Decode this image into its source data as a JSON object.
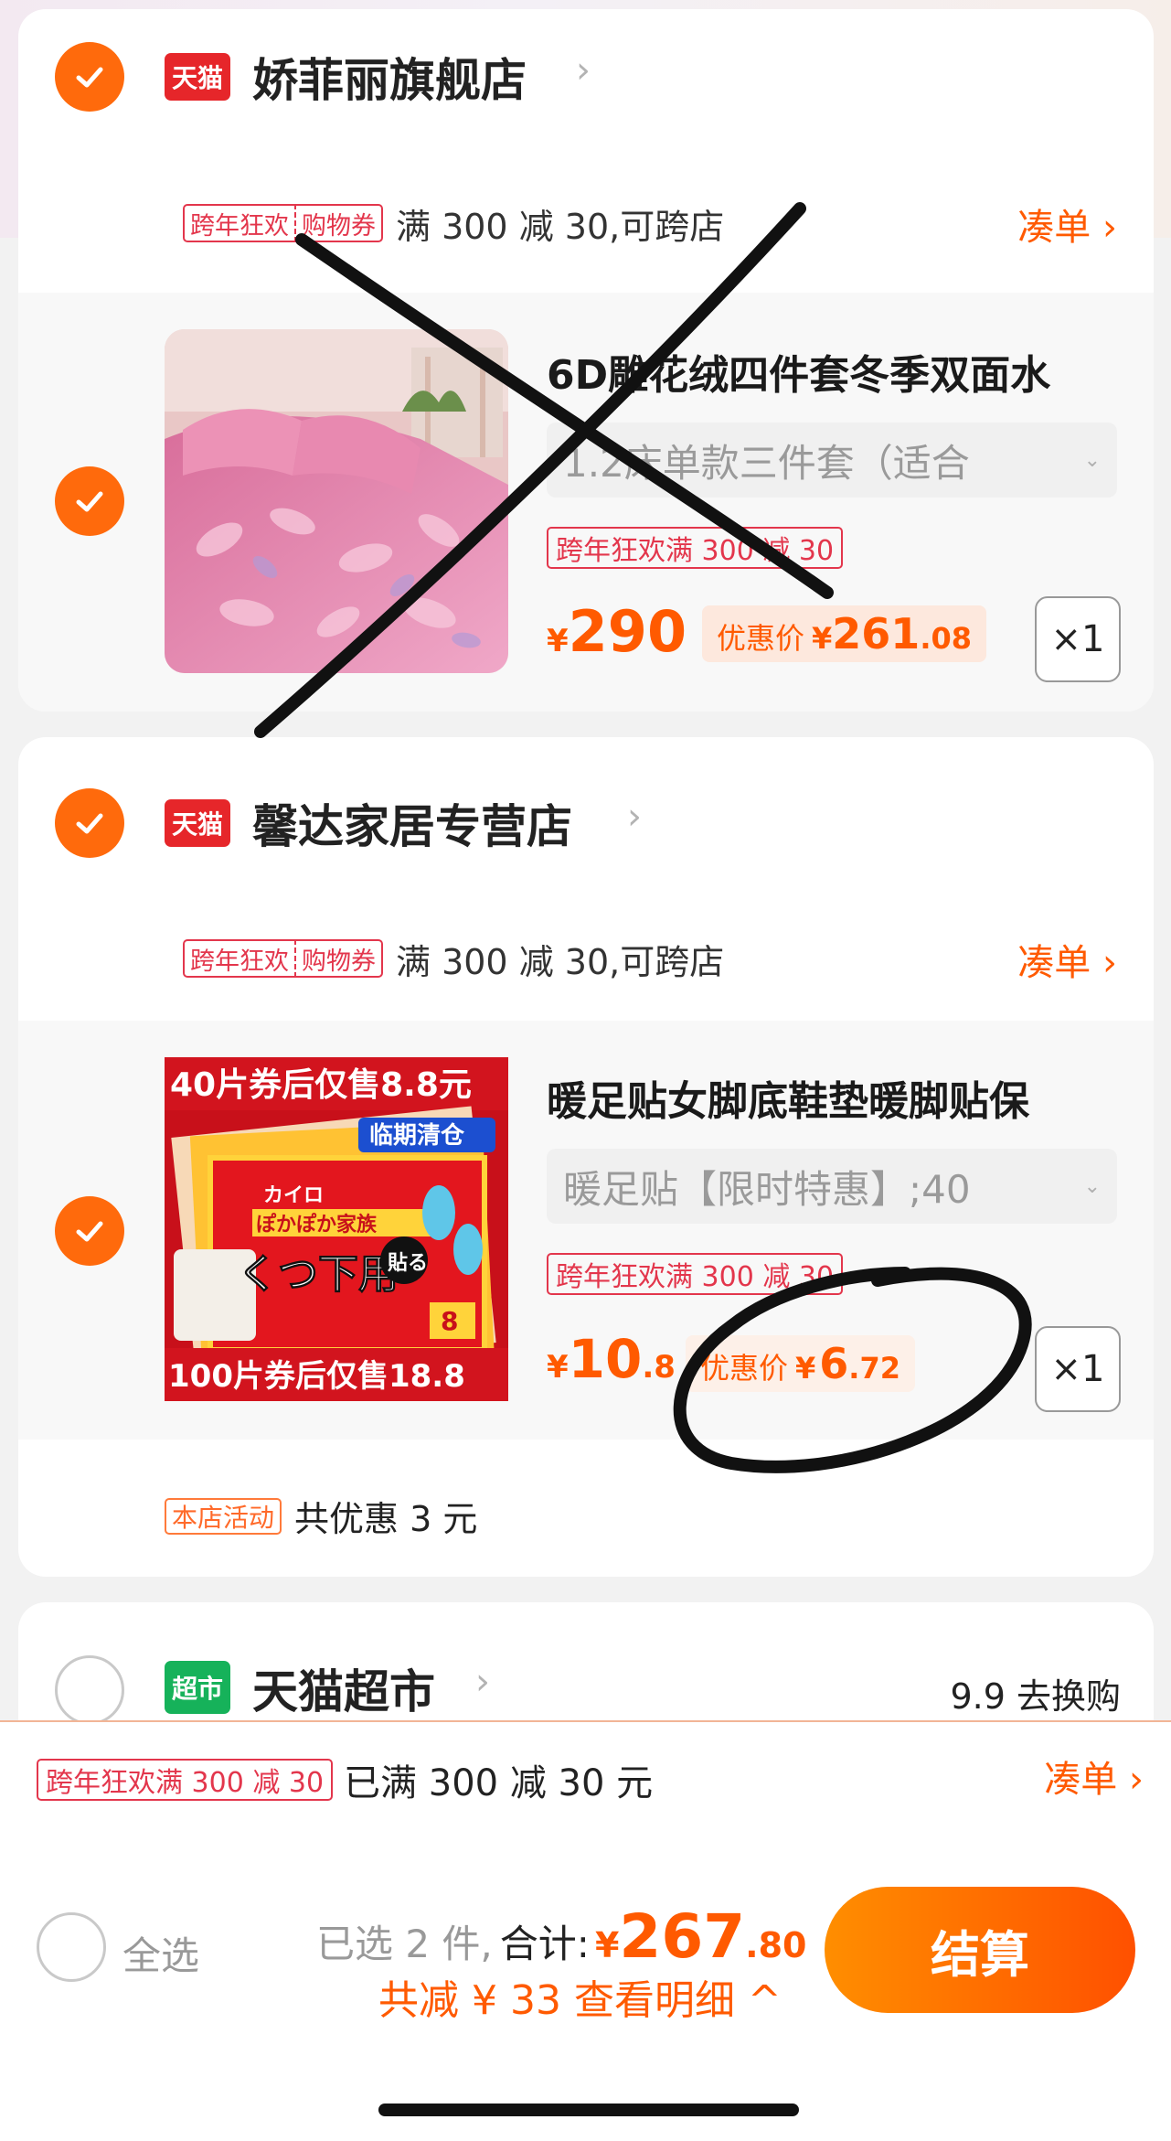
{
  "shops": [
    {
      "name": "娇菲丽旗舰店",
      "logo_text": "天猫",
      "promo_tags": [
        "跨年狂欢",
        "购物券"
      ],
      "promo_text": "满 300 减 30,可跨店",
      "cou_label": "凑单 ›",
      "item": {
        "title": "6D雕花绒四件套冬季双面水",
        "sku": "1.2床单款三件套（适合",
        "price_tag": "跨年狂欢满 300 减 30",
        "currency": "¥",
        "price": "290",
        "discount_label": "优惠价",
        "discount_currency": "¥",
        "discount_int": "261",
        "discount_dec": ".08",
        "qty": "×1"
      }
    },
    {
      "name": "馨达家居专营店",
      "logo_text": "天猫",
      "promo_tags": [
        "跨年狂欢",
        "购物券"
      ],
      "promo_text": "满 300 减 30,可跨店",
      "cou_label": "凑单 ›",
      "item": {
        "title": "暖足贴女脚底鞋垫暖脚贴保",
        "sku": "暖足贴【限时特惠】;40",
        "price_tag": "跨年狂欢满 300 减 30",
        "currency": "¥",
        "price": "10",
        "price_dec": ".8",
        "discount_label": "优惠价",
        "discount_currency": "¥",
        "discount_int": "6",
        "discount_dec": ".72",
        "qty": "×1",
        "image_text": {
          "top": "40片券后仅售8.8元",
          "badge": "临期清仓",
          "brand": "カイロ",
          "sub": "ぽかぽか家族",
          "main": "くつ下用",
          "tie": "貼る",
          "hours": "8",
          "bottom": "100片券后仅售18.8"
        }
      },
      "store_activity_tag": "本店活动",
      "store_activity_text": "共优惠 3 元"
    },
    {
      "name": "天猫超市",
      "logo_text": "超市",
      "right_text": "9.9 去换购"
    }
  ],
  "bottom_bar": {
    "promo_tag": "跨年狂欢满 300 减 30",
    "promo_text": "已满 300 减 30 元",
    "cou_label": "凑单 ›",
    "select_all": "全选",
    "selected_text": "已选 2 件,",
    "total_label": "合计:",
    "currency": "¥",
    "total_int": "267",
    "total_dec": ".80",
    "saved_text": "共减 ¥ 33  查看明细 ^",
    "checkout_label": "结算"
  },
  "colors": {
    "accent": "#ff5a00",
    "check": "#ff6a0c",
    "tag_red": "#e3364c",
    "tmall_red": "#e6262a",
    "supermarket_green": "#16b25a"
  }
}
